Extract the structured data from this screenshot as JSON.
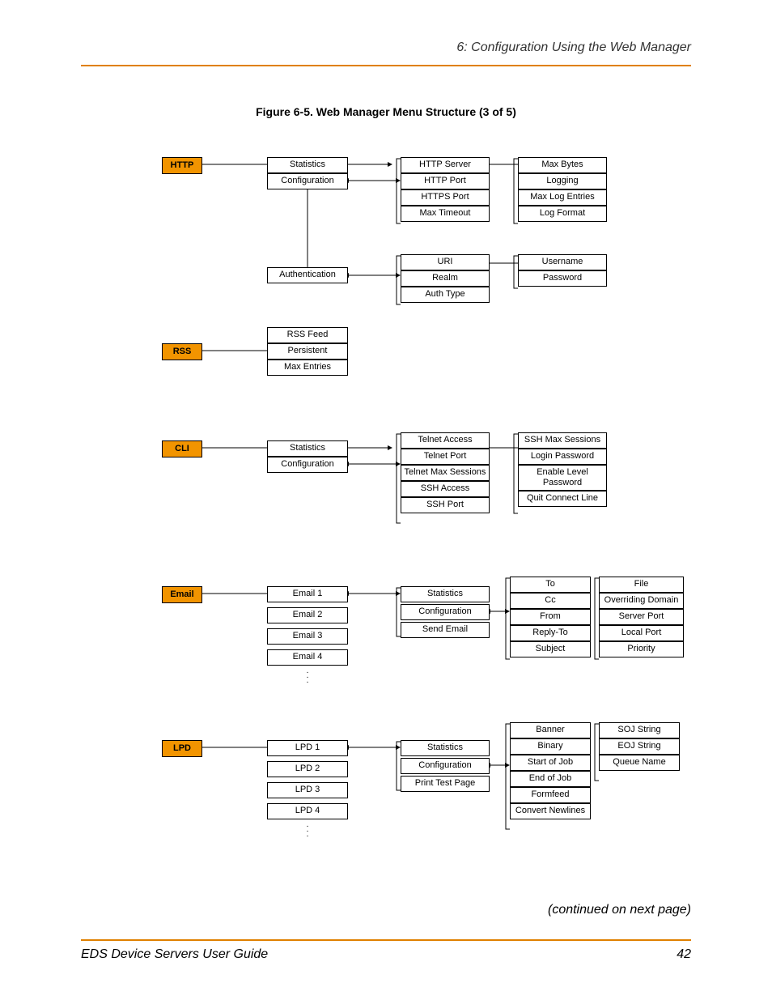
{
  "header": "6: Configuration Using the Web Manager",
  "figure_title": "Figure 6-5. Web Manager Menu Structure (3 of 5)",
  "continued": "(continued on next page)",
  "footer_left": "EDS Device Servers User Guide",
  "footer_right": "42",
  "diagram": {
    "http": {
      "root": "HTTP",
      "col1": [
        "Statistics",
        "Configuration"
      ],
      "col2a": [
        "HTTP Server",
        "HTTP Port",
        "HTTPS Port",
        "Max Timeout"
      ],
      "col3a": [
        "Max Bytes",
        "Logging",
        "Max Log Entries",
        "Log Format"
      ],
      "auth": "Authentication",
      "col2b": [
        "URI",
        "Realm",
        "Auth Type"
      ],
      "col3b": [
        "Username",
        "Password"
      ]
    },
    "rss": {
      "root": "RSS",
      "col1": [
        "RSS Feed",
        "Persistent",
        "Max Entries"
      ]
    },
    "cli": {
      "root": "CLI",
      "col1": [
        "Statistics",
        "Configuration"
      ],
      "col2": [
        "Telnet Access",
        "Telnet Port",
        "Telnet Max Sessions",
        "SSH Access",
        "SSH Port"
      ],
      "col3": [
        "SSH Max Sessions",
        "Login Password",
        "Enable Level Password",
        "Quit Connect Line"
      ]
    },
    "email": {
      "root": "Email",
      "col1": [
        "Email 1",
        "Email 2",
        "Email 3",
        "Email 4"
      ],
      "col2": [
        "Statistics",
        "Configuration",
        "Send Email"
      ],
      "col3": [
        "To",
        "Cc",
        "From",
        "Reply-To",
        "Subject"
      ],
      "col4": [
        "File",
        "Overriding Domain",
        "Server Port",
        "Local Port",
        "Priority"
      ]
    },
    "lpd": {
      "root": "LPD",
      "col1": [
        "LPD 1",
        "LPD 2",
        "LPD 3",
        "LPD 4"
      ],
      "col2": [
        "Statistics",
        "Configuration",
        "Print Test Page"
      ],
      "col3": [
        "Banner",
        "Binary",
        "Start of Job",
        "End of Job",
        "Formfeed",
        "Convert Newlines"
      ],
      "col4": [
        "SOJ String",
        "EOJ String",
        "Queue Name"
      ]
    }
  }
}
